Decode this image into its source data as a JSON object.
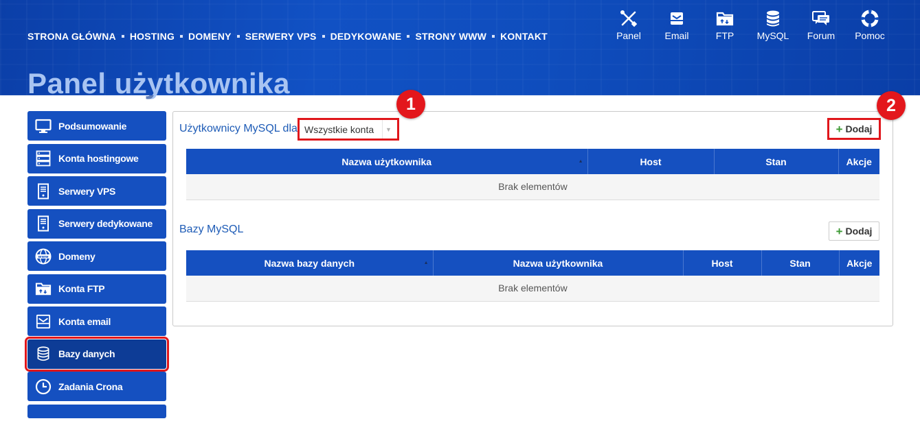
{
  "topnav": {
    "items": [
      "STRONA GŁÓWNA",
      "HOSTING",
      "DOMENY",
      "SERWERY VPS",
      "DEDYKOWANE",
      "STRONY WWW",
      "KONTAKT"
    ]
  },
  "quicklinks": [
    {
      "label": "Panel",
      "icon": "tools-icon"
    },
    {
      "label": "Email",
      "icon": "email-icon"
    },
    {
      "label": "FTP",
      "icon": "ftp-folder-icon"
    },
    {
      "label": "MySQL",
      "icon": "database-icon"
    },
    {
      "label": "Forum",
      "icon": "forum-icon"
    },
    {
      "label": "Pomoc",
      "icon": "lifebuoy-icon"
    }
  ],
  "page": {
    "title": "Panel użytkownika"
  },
  "sidebar": {
    "items": [
      {
        "label": "Podsumowanie",
        "icon": "monitor-icon"
      },
      {
        "label": "Konta hostingowe",
        "icon": "server-icon"
      },
      {
        "label": "Serwery VPS",
        "icon": "vps-icon"
      },
      {
        "label": "Serwery dedykowane",
        "icon": "dedicated-server-icon"
      },
      {
        "label": "Domeny",
        "icon": "www-globe-icon"
      },
      {
        "label": "Konta FTP",
        "icon": "ftp-folder-icon"
      },
      {
        "label": "Konta email",
        "icon": "email-icon"
      },
      {
        "label": "Bazy danych",
        "icon": "database-icon",
        "active": true
      },
      {
        "label": "Zadania Crona",
        "icon": "clock-icon"
      }
    ]
  },
  "users_section": {
    "title": "Użytkownicy MySQL dla",
    "filter_value": "Wszystkie konta",
    "add_label": "Dodaj",
    "columns": [
      "Nazwa użytkownika",
      "Host",
      "Stan",
      "Akcje"
    ],
    "empty_text": "Brak elementów"
  },
  "databases_section": {
    "title": "Bazy MySQL",
    "add_label": "Dodaj",
    "columns": [
      "Nazwa bazy danych",
      "Nazwa użytkownika",
      "Host",
      "Stan",
      "Akcje"
    ],
    "empty_text": "Brak elementów"
  },
  "badges": [
    "1",
    "2"
  ],
  "colors": {
    "brand_blue": "#1550c0",
    "highlight_red": "#e0161b",
    "title_blue": "#1d5bb6"
  }
}
